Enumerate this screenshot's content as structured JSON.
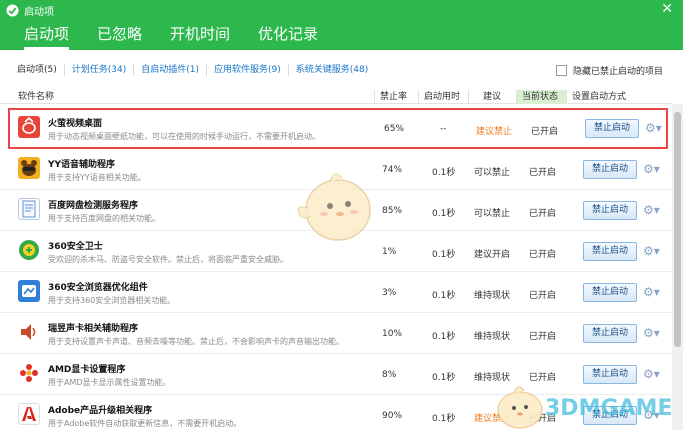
{
  "window": {
    "title": "启动项",
    "close_glyph": "✕"
  },
  "tabs": [
    {
      "label": "启动项",
      "active": true
    },
    {
      "label": "已忽略"
    },
    {
      "label": "开机时间"
    },
    {
      "label": "优化记录"
    }
  ],
  "subtabs": [
    {
      "label": "启动项(5)"
    },
    {
      "label": "计划任务(34)"
    },
    {
      "label": "自启动插件(1)"
    },
    {
      "label": "应用软件服务(9)"
    },
    {
      "label": "系统关键服务(48)"
    }
  ],
  "hide_option": {
    "label": "隐藏已禁止启动的项目",
    "checked": false
  },
  "columns": {
    "name": "软件名称",
    "rate": "禁止率",
    "time": "启动用时",
    "advice": "建议",
    "status": "当前状态",
    "action": "设置启动方式"
  },
  "rows": [
    {
      "name": "火萤视频桌面",
      "desc": "用于动态视频桌面壁纸功能，可以在使用的时候手动运行，不需要开机启动。",
      "rate": "65%",
      "time": "--",
      "advice": "建议禁止",
      "advice_warn": true,
      "status": "已开启",
      "button": "禁止启动",
      "icon": "firefly-icon",
      "color": "#e8443a",
      "selected": true
    },
    {
      "name": "YY语音辅助程序",
      "desc": "用于支持YY语音相关功能。",
      "rate": "74%",
      "time": "0.1秒",
      "advice": "可以禁止",
      "advice_warn": false,
      "status": "已开启",
      "button": "禁止启动",
      "icon": "yy-bear-icon",
      "color": "#f2b01e"
    },
    {
      "name": "百度网盘检测服务程序",
      "desc": "用于支持百度网盘的相关功能。",
      "rate": "85%",
      "time": "0.1秒",
      "advice": "可以禁止",
      "advice_warn": false,
      "status": "已开启",
      "button": "禁止启动",
      "icon": "document-icon",
      "color": "#5b8fd6"
    },
    {
      "name": "360安全卫士",
      "desc": "受欢迎的杀木马、防盗号安全软件。禁止后，将面临严重安全威胁。",
      "rate": "1%",
      "time": "0.1秒",
      "advice": "建议开启",
      "advice_warn": false,
      "status": "已开启",
      "button": "禁止启动",
      "icon": "360-shield-icon",
      "color": "#34a84a"
    },
    {
      "name": "360安全浏览器优化组件",
      "desc": "用于支持360安全浏览器相关功能。",
      "rate": "3%",
      "time": "0.1秒",
      "advice": "维持现状",
      "advice_warn": false,
      "status": "已开启",
      "button": "禁止启动",
      "icon": "360-browser-icon",
      "color": "#2f7fd8"
    },
    {
      "name": "瑞昱声卡相关辅助程序",
      "desc": "用于支持设置声卡声道、音频去噪等功能。禁止后，不会影响声卡的声音输出功能。",
      "rate": "10%",
      "time": "0.1秒",
      "advice": "维持现状",
      "advice_warn": false,
      "status": "已开启",
      "button": "禁止启动",
      "icon": "speaker-icon",
      "color": "#c94a2a"
    },
    {
      "name": "AMD显卡设置程序",
      "desc": "用于AMD显卡显示属性设置功能。",
      "rate": "8%",
      "time": "0.1秒",
      "advice": "维持现状",
      "advice_warn": false,
      "status": "已开启",
      "button": "禁止启动",
      "icon": "amd-flower-icon",
      "color": "#e0312b"
    },
    {
      "name": "Adobe产品升级相关程序",
      "desc": "用于Adobe软件自动获取更新信息，不需要开机启动。",
      "rate": "90%",
      "time": "0.1秒",
      "advice": "建议禁止",
      "advice_warn": true,
      "status": "已开启",
      "button": "禁止启动",
      "icon": "adobe-icon",
      "color": "#d8261c"
    }
  ],
  "watermark": "3DMGAME"
}
